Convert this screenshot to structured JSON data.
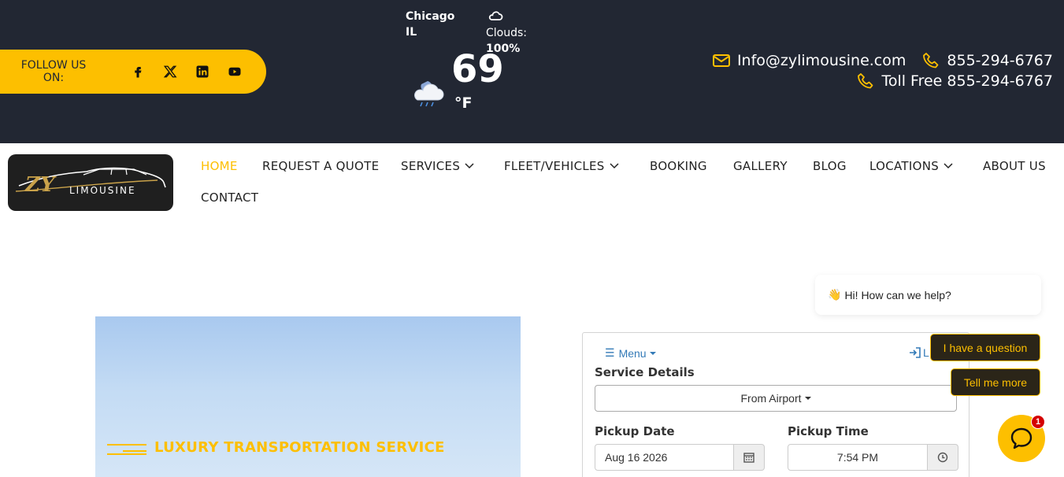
{
  "topbar": {
    "follow_label": "FOLLOW US ON:",
    "social": [
      {
        "icon": "facebook-icon"
      },
      {
        "icon": "x-twitter-icon"
      },
      {
        "icon": "linkedin-icon"
      },
      {
        "icon": "youtube-icon"
      }
    ],
    "weather": {
      "city": "Chicago",
      "state": "IL",
      "clouds_label": "Clouds:",
      "clouds_value": "100%",
      "temperature": "69",
      "unit": "°F",
      "icon": "cloud-rain-icon"
    },
    "email": "Info@zylimousine.com",
    "phone": "855-294-6767",
    "toll_free": "Toll Free 855-294-6767"
  },
  "logo": {
    "text": "LIMOUSINE",
    "monogram": "ZY"
  },
  "nav": {
    "items": [
      {
        "label": "HOME",
        "active": true
      },
      {
        "label": "REQUEST A QUOTE"
      },
      {
        "label": "SERVICES",
        "dropdown": true
      },
      {
        "label": "FLEET/VEHICLES",
        "dropdown": true
      },
      {
        "label": "BOOKING"
      },
      {
        "label": "GALLERY"
      },
      {
        "label": "BLOG"
      },
      {
        "label": "LOCATIONS",
        "dropdown": true
      },
      {
        "label": "ABOUT US"
      },
      {
        "label": "CONTACT"
      }
    ]
  },
  "hero": {
    "tagline": "LUXURY TRANSPORTATION SERVICE"
  },
  "booking": {
    "menu_label": "Menu",
    "login_label": "L",
    "service_details_label": "Service Details",
    "service_value": "From Airport",
    "pickup_date_label": "Pickup Date",
    "pickup_date_value": "Aug 16 2026",
    "pickup_time_label": "Pickup Time",
    "pickup_time_value": "7:54 PM"
  },
  "chat": {
    "greeting": "Hi! How can we help?",
    "btn_question": "I have a question",
    "btn_more": "Tell me more",
    "badge_count": "1"
  },
  "colors": {
    "accent": "#fdbf00",
    "dark": "#222733",
    "link": "#337ab7"
  }
}
